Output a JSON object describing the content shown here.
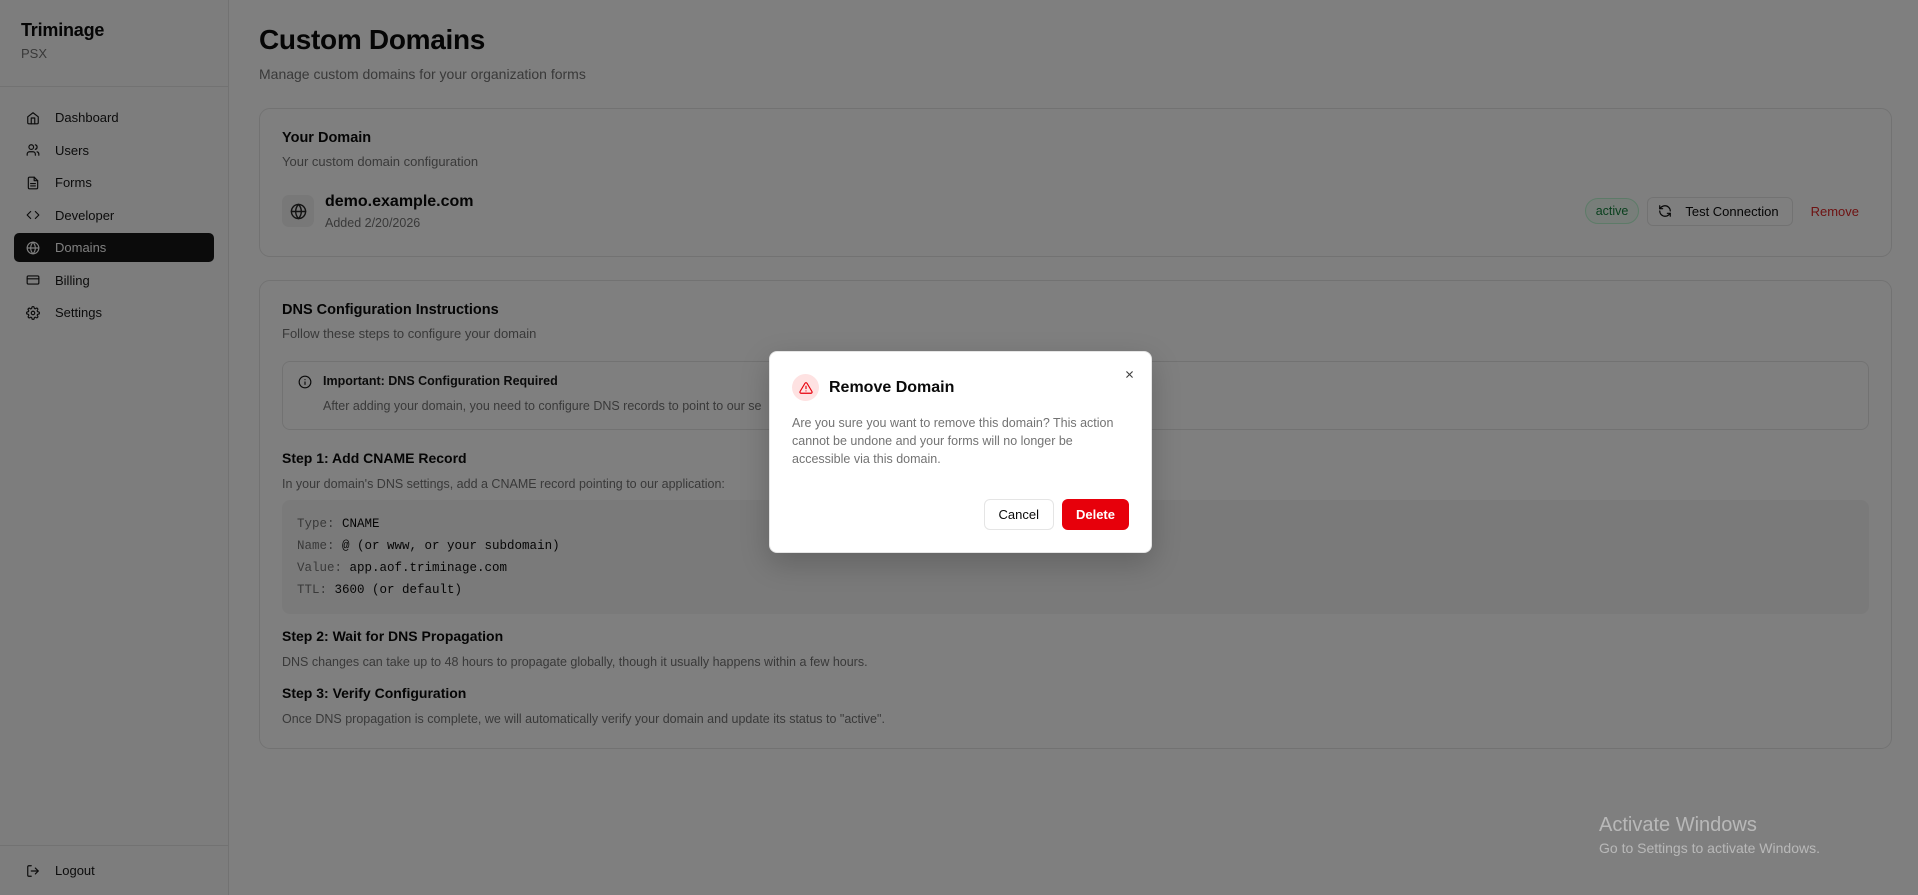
{
  "sidebar": {
    "brand": "Triminage",
    "org": "PSX",
    "items": [
      {
        "label": "Dashboard",
        "icon": "home-icon"
      },
      {
        "label": "Users",
        "icon": "users-icon"
      },
      {
        "label": "Forms",
        "icon": "file-text-icon"
      },
      {
        "label": "Developer",
        "icon": "code-icon"
      },
      {
        "label": "Domains",
        "icon": "globe-icon",
        "active": true
      },
      {
        "label": "Billing",
        "icon": "credit-card-icon"
      },
      {
        "label": "Settings",
        "icon": "gear-icon"
      }
    ],
    "logout": "Logout"
  },
  "page": {
    "title": "Custom Domains",
    "subtitle": "Manage custom domains for your organization forms"
  },
  "domain_card": {
    "title": "Your Domain",
    "description": "Your custom domain configuration",
    "domain": "demo.example.com",
    "added": "Added 2/20/2026",
    "status": "active",
    "test_button": "Test Connection",
    "remove_button": "Remove",
    "status_color": "#15803d",
    "remove_color": "#dc2626"
  },
  "dns_card": {
    "title": "DNS Configuration Instructions",
    "description": "Follow these steps to configure your domain",
    "alert_title": "Important: DNS Configuration Required",
    "alert_text": "After adding your domain, you need to configure DNS records to point to our se",
    "step1_title": "Step 1: Add CNAME Record",
    "step1_text": "In your domain's DNS settings, add a CNAME record pointing to our application:",
    "code": [
      {
        "key": "Type:",
        "value": "CNAME"
      },
      {
        "key": "Name:",
        "value": "@ (or www, or your subdomain)"
      },
      {
        "key": "Value:",
        "value": "app.aof.triminage.com"
      },
      {
        "key": "TTL:",
        "value": "3600 (or default)"
      }
    ],
    "step2_title": "Step 2: Wait for DNS Propagation",
    "step2_text": "DNS changes can take up to 48 hours to propagate globally, though it usually happens within a few hours.",
    "step3_title": "Step 3: Verify Configuration",
    "step3_text": "Once DNS propagation is complete, we will automatically verify your domain and update its status to \"active\"."
  },
  "modal": {
    "title": "Remove Domain",
    "text": "Are you sure you want to remove this domain? This action cannot be undone and your forms will no longer be accessible via this domain.",
    "cancel": "Cancel",
    "delete": "Delete",
    "delete_color": "#e7000b"
  },
  "watermark": {
    "title": "Activate Windows",
    "subtitle": "Go to Settings to activate Windows."
  }
}
